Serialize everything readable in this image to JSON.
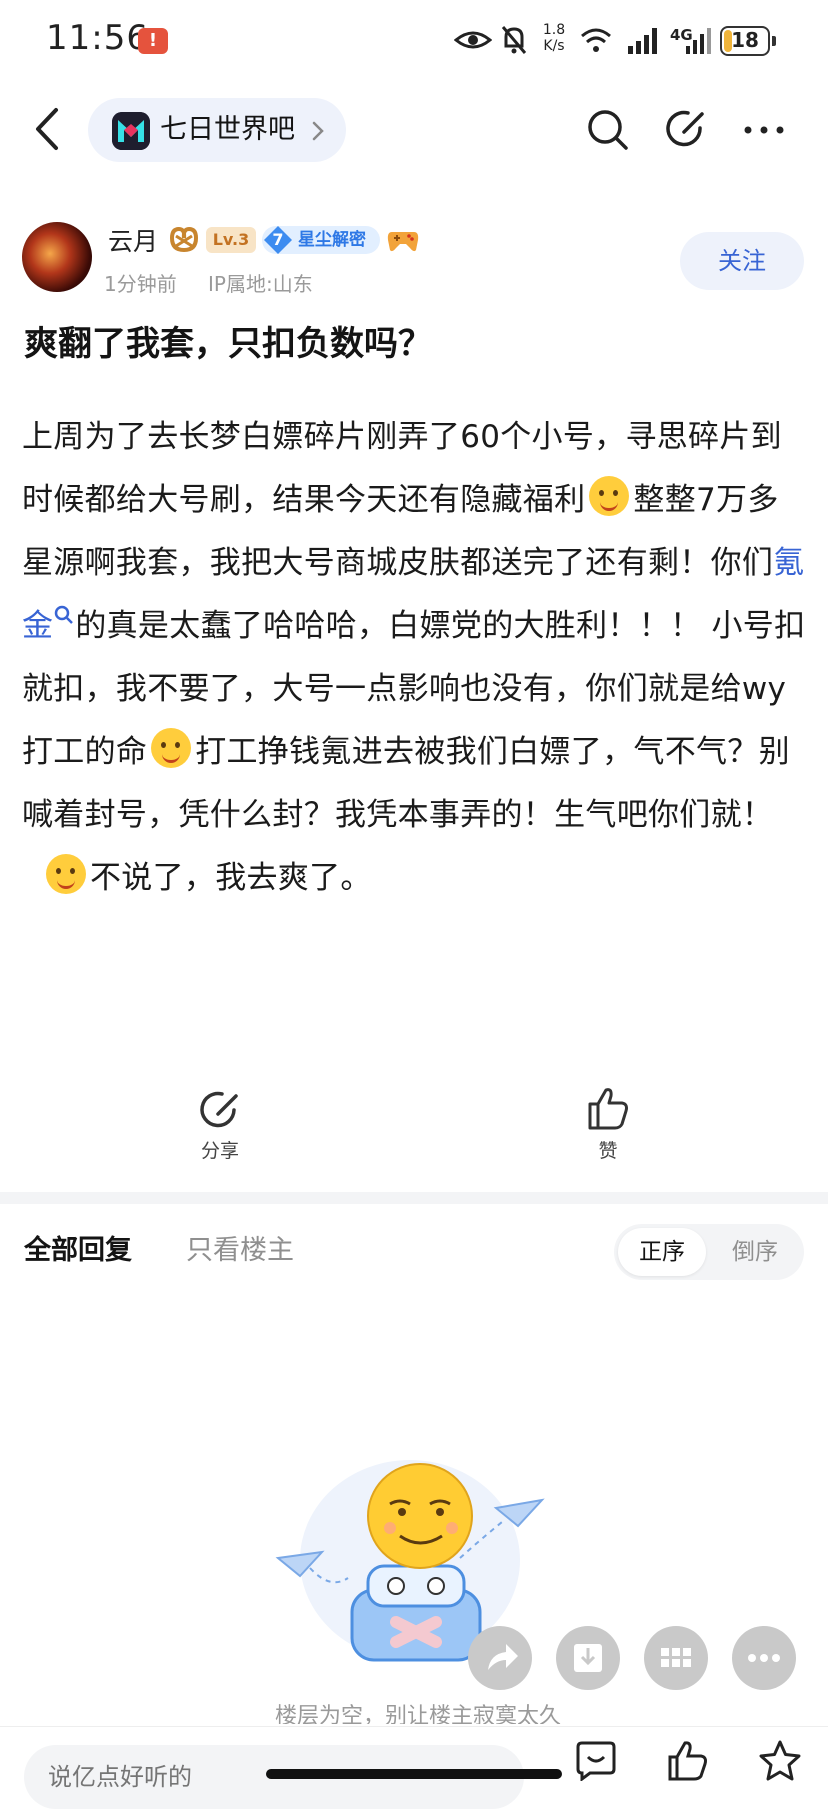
{
  "status_bar": {
    "time": "11:56",
    "alert_badge": "!",
    "net_speed": "1.8 K/s",
    "network": "4G",
    "battery": "18",
    "battery_level": 0.18
  },
  "nav": {
    "forum_name": "七日世界吧"
  },
  "author": {
    "name": "云月",
    "level": "Lv.3",
    "badge_number": "7",
    "badge_text": "星尘解密",
    "post_time": "1分钟前",
    "ip_location": "IP属地:山东",
    "follow_label": "关注"
  },
  "post": {
    "title": "爽翻了我套，只扣负数吗？",
    "body_1": "上周为了去长梦白嫖碎片刚弄了60个小号，寻思碎片到时候都给大号刷，结果今天还有隐藏福利",
    "body_2": "整整7万多星源啊我套，我把大号商城皮肤都送完了还有剩！你们",
    "keyword": "氪金",
    "body_3": "的真是太蠢了哈哈哈，白嫖党的大胜利！！！ 小号扣就扣，我不要了，大号一点影响也没有，你们就是给wy打工的命",
    "body_4": "打工挣钱氪进去被我们白嫖了，气不气？别喊着封号，凭什么封？我凭本事弄的！生气吧你们就！",
    "body_5": "不说了，我去爽了。"
  },
  "actions": {
    "share_label": "分享",
    "like_label": "赞"
  },
  "replies": {
    "tab_all": "全部回复",
    "tab_op_only": "只看楼主",
    "sort_asc": "正序",
    "sort_desc": "倒序",
    "empty_text": "楼层为空，别让楼主寂寞太久"
  },
  "bottom_bar": {
    "reply_placeholder": "说亿点好听的"
  },
  "colors": {
    "accent": "#3864d4",
    "chip_bg": "#eef2fb",
    "badge_blue": "#2e78e6"
  }
}
